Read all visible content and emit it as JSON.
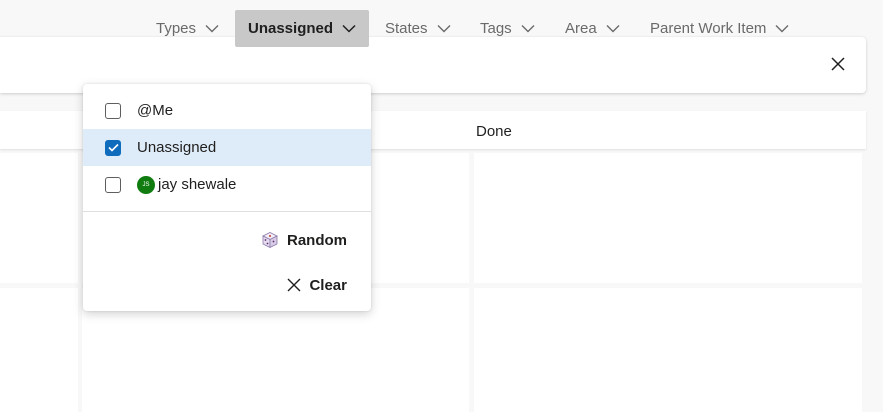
{
  "filters": [
    {
      "label": "Types",
      "icon": "chevron-down-icon"
    },
    {
      "label": "Unassigned",
      "icon": "chevron-down-icon",
      "active": true
    },
    {
      "label": "States",
      "icon": "chevron-down-icon"
    },
    {
      "label": "Tags",
      "icon": "chevron-down-icon"
    },
    {
      "label": "Area",
      "icon": "chevron-down-icon"
    },
    {
      "label": "Parent Work Item",
      "icon": "chevron-down-icon"
    }
  ],
  "close_icon": "close-icon",
  "board": {
    "column_header": "Done"
  },
  "dropdown": {
    "options": [
      {
        "label": "@Me",
        "checked": false
      },
      {
        "label": "Unassigned",
        "checked": true
      },
      {
        "label": "jay shewale",
        "checked": false,
        "avatar_initials": "JS",
        "avatar_color": "#107c10"
      }
    ],
    "actions": {
      "random_label": "Random",
      "random_icon": "dice-icon",
      "clear_label": "Clear",
      "clear_icon": "close-icon"
    }
  },
  "colors": {
    "accent": "#0f6cbd",
    "selected_row": "#deecf9",
    "active_filter": "#c8c8c8"
  }
}
